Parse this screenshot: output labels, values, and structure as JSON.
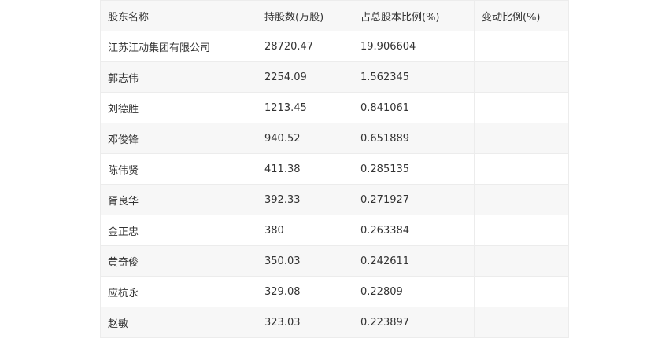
{
  "table": {
    "headers": [
      "股东名称",
      "持股数(万股)",
      "占总股本比例(%)",
      "变动比例(%)"
    ],
    "rows": [
      [
        "江苏江动集团有限公司",
        "28720.47",
        "19.906604",
        ""
      ],
      [
        "郭志伟",
        "2254.09",
        "1.562345",
        ""
      ],
      [
        "刘德胜",
        "1213.45",
        "0.841061",
        ""
      ],
      [
        "邓俊锋",
        "940.52",
        "0.651889",
        ""
      ],
      [
        "陈伟贤",
        "411.38",
        "0.285135",
        ""
      ],
      [
        "胥良华",
        "392.33",
        "0.271927",
        ""
      ],
      [
        "金正忠",
        "380",
        "0.263384",
        ""
      ],
      [
        "黄奇俊",
        "350.03",
        "0.242611",
        ""
      ],
      [
        "应杭永",
        "329.08",
        "0.22809",
        ""
      ],
      [
        "赵敏",
        "323.03",
        "0.223897",
        ""
      ]
    ]
  }
}
